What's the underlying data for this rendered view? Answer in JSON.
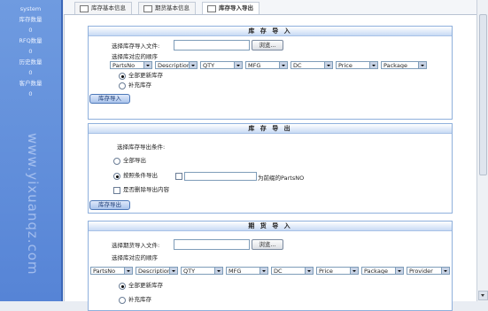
{
  "sidebar": {
    "lines": [
      "system",
      "库存数量",
      "0",
      "RFQ数量",
      "0",
      "历史数量",
      "0",
      "客户数量",
      "0"
    ],
    "watermark": "www.yixuanqz.com"
  },
  "tabs": [
    {
      "label": "库存基本信息"
    },
    {
      "label": "期货基本信息"
    },
    {
      "label": "库存导入导出"
    }
  ],
  "stock_import": {
    "title": "库 存 导 入",
    "file_label": "选择库存导入文件:",
    "browse": "浏览...",
    "order_label": "选择库对应的顺序",
    "columns": [
      "PartsNo",
      "Description",
      "QTY",
      "MFG",
      "DC",
      "Price",
      "Package"
    ],
    "options": [
      {
        "label": "全部更新库存",
        "checked": true
      },
      {
        "label": "补充库存",
        "checked": false
      }
    ],
    "import_button": "库存导入"
  },
  "stock_export": {
    "title": "库 存 导 出",
    "condition_label": "选择库存导出条件:",
    "options": [
      {
        "label": "全部导出",
        "checked": false
      },
      {
        "label": "按照条件导出",
        "checked": true
      }
    ],
    "condition_suffix": "为前缀的PartsNO",
    "delete_label": "是否删除导出内容",
    "export_button": "库存导出"
  },
  "futures_import": {
    "title": "期 货 导 入",
    "file_label": "选择期货导入文件:",
    "browse": "浏览...",
    "order_label": "选择库对应的顺序",
    "columns": [
      "PartsNo",
      "Description",
      "QTY",
      "MFG",
      "DC",
      "Price",
      "Package",
      "Provider"
    ],
    "options": [
      {
        "label": "全部更新库存",
        "checked": true
      },
      {
        "label": "补充库存",
        "checked": false
      }
    ]
  }
}
